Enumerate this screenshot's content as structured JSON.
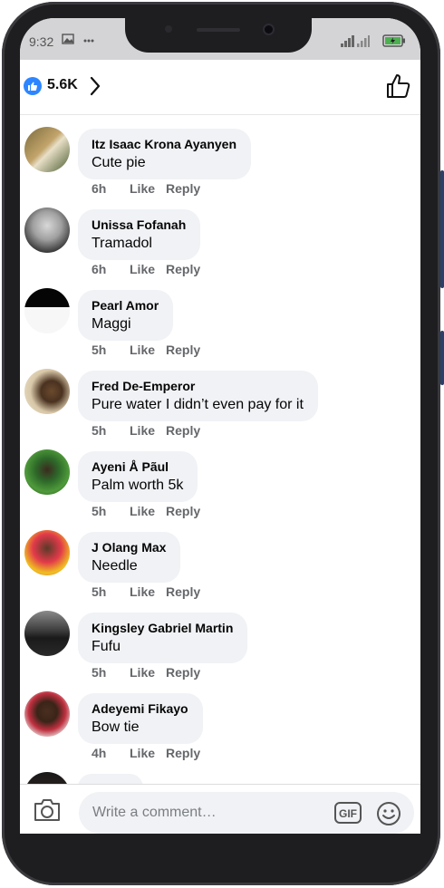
{
  "status": {
    "time": "9:32"
  },
  "header": {
    "like_count": "5.6K"
  },
  "actions": {
    "like": "Like",
    "reply": "Reply"
  },
  "comments": [
    {
      "author": "Itz Isaac Krona Ayanyen",
      "text": "Cute pie",
      "time": "6h"
    },
    {
      "author": "Unissa Fofanah",
      "text": "Tramadol",
      "time": "6h"
    },
    {
      "author": "Pearl Amor",
      "text": "Maggi",
      "time": "5h"
    },
    {
      "author": "Fred De-Emperor",
      "text": "Pure water I didn’t even pay for it",
      "time": "5h"
    },
    {
      "author": "Ayeni Å Pãul",
      "text": "Palm worth 5k",
      "time": "5h"
    },
    {
      "author": "J Olang Max",
      "text": "Needle",
      "time": "5h"
    },
    {
      "author": "Kingsley Gabriel Martin",
      "text": "Fufu",
      "time": "5h"
    },
    {
      "author": "Adeyemi Fikayo",
      "text": "Bow tie",
      "time": "4h"
    }
  ],
  "composer": {
    "placeholder": "Write a comment…",
    "gif_label": "GIF"
  },
  "colors": {
    "accent": "#2d86ff",
    "bubble": "#f0f2f5",
    "meta": "#65676b"
  }
}
